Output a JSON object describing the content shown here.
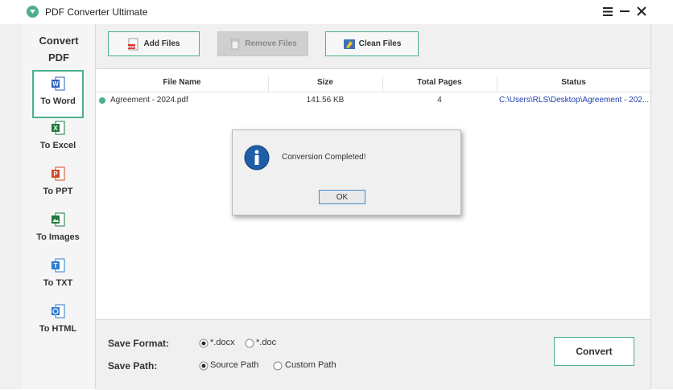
{
  "window": {
    "title": "PDF Converter Ultimate",
    "controls": [
      "menu-icon",
      "minimize-icon",
      "close-icon"
    ]
  },
  "sidebar": {
    "heading_line1": "Convert",
    "heading_line2": "PDF",
    "items": [
      {
        "label": "To Word",
        "icon": "word-icon",
        "color": "#2b5fb8",
        "active": true
      },
      {
        "label": "To Excel",
        "icon": "excel-icon",
        "color": "#1f7a3f",
        "active": false
      },
      {
        "label": "To PPT",
        "icon": "ppt-icon",
        "color": "#d24726",
        "active": false
      },
      {
        "label": "To Images",
        "icon": "images-icon",
        "color": "#1f7a3f",
        "active": false
      },
      {
        "label": "To TXT",
        "icon": "txt-icon",
        "color": "#2b7bd0",
        "active": false
      },
      {
        "label": "To HTML",
        "icon": "html-icon",
        "color": "#2b7bd0",
        "active": false
      }
    ]
  },
  "toolbar": {
    "add_files": "Add Files",
    "remove_files": "Remove Files",
    "clean_files": "Clean Files"
  },
  "table": {
    "headers": [
      "File Name",
      "Size",
      "Total Pages",
      "Status"
    ],
    "rows": [
      {
        "file_name": "Agreement - 2024.pdf",
        "size": "141.56 KB",
        "total_pages": "4",
        "status": "C:\\Users\\RLS\\Desktop\\Agreement - 202..."
      }
    ]
  },
  "options": {
    "save_format_label": "Save Format:",
    "format_options": [
      {
        "label": "*.docx",
        "selected": true
      },
      {
        "label": "*.doc",
        "selected": false
      }
    ],
    "save_path_label": "Save Path:",
    "path_options": [
      {
        "label": "Source Path",
        "selected": true
      },
      {
        "label": "Custom Path",
        "selected": false
      }
    ],
    "convert_label": "Convert"
  },
  "dialog": {
    "icon": "info-icon",
    "message": "Conversion Completed!",
    "ok_label": "OK"
  },
  "colors": {
    "accent": "#4db08f",
    "status_link": "#1f3fb0",
    "info_blue": "#1f5fa8"
  }
}
